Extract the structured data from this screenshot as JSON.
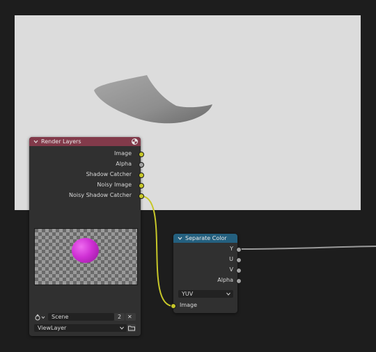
{
  "render_layers": {
    "title": "Render Layers",
    "outputs": [
      "Image",
      "Alpha",
      "Shadow Catcher",
      "Noisy Image",
      "Noisy Shadow Catcher"
    ],
    "scene_name": "Scene",
    "scene_users": "2",
    "close_glyph": "✕",
    "view_layer": "ViewLayer",
    "header_color": "#823a4a"
  },
  "separate_color": {
    "title": "Separate Color",
    "outputs": [
      "Y",
      "U",
      "V",
      "Alpha"
    ],
    "mode": "YUV",
    "input_label": "Image",
    "header_color": "#24607f"
  },
  "colors": {
    "socket_color": "#c7c729",
    "socket_gray": "#a1a1a1",
    "link_yellow": "#c7c729",
    "link_gray": "#9a9a9a",
    "preview_sphere": "#d432d8"
  },
  "icons": {
    "collapse": "chevron-down-icon",
    "render_layers": "render-icon",
    "scene": "scene-icon",
    "dropdown": "dropdown-arrow-icon",
    "browse": "folder-icon"
  }
}
